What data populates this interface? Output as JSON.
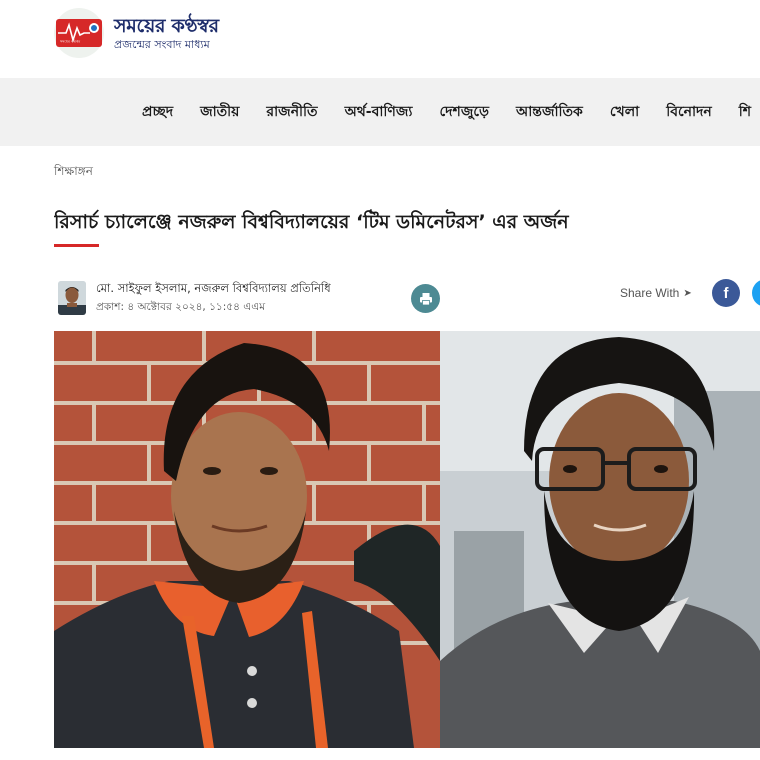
{
  "site": {
    "name": "সময়ের কণ্ঠস্বর",
    "tagline": "প্রজন্মের সংবাদ মাধ্যম",
    "logo_badge": "সময়ের কণ্ঠস্বর",
    "brand_red": "#d62828",
    "brand_blue": "#1e2d6b"
  },
  "nav": {
    "items": [
      {
        "label": "প্রচ্ছদ"
      },
      {
        "label": "জাতীয়"
      },
      {
        "label": "রাজনীতি"
      },
      {
        "label": "অর্থ-বাণিজ্য"
      },
      {
        "label": "দেশজুড়ে"
      },
      {
        "label": "আন্তর্জাতিক"
      },
      {
        "label": "খেলা"
      },
      {
        "label": "বিনোদন"
      },
      {
        "label": "শি"
      }
    ]
  },
  "article": {
    "category": "শিক্ষাঙ্গন",
    "headline": "রিসার্চ চ্যালেঞ্জে নজরুল বিশ্ববিদ্যালয়ের ‘টিম ডমিনেটরস’ এর অর্জন",
    "author": "মো. সাইফুল ইসলাম, নজরুল বিশ্ববিদ্যালয় প্রতিনিধি",
    "published": "প্রকাশ: ৪ অক্টোবর ২০২৪, ১১:৫৪ এএম",
    "share_label": "Share With",
    "share_arrow": "➤",
    "facebook_glyph": "f",
    "hero_alt_left": "brick-wall-portrait",
    "hero_alt_right": "glasses-beard-portrait"
  },
  "icons": {
    "print": "print-icon",
    "facebook": "facebook-icon",
    "twitter": "twitter-icon"
  }
}
